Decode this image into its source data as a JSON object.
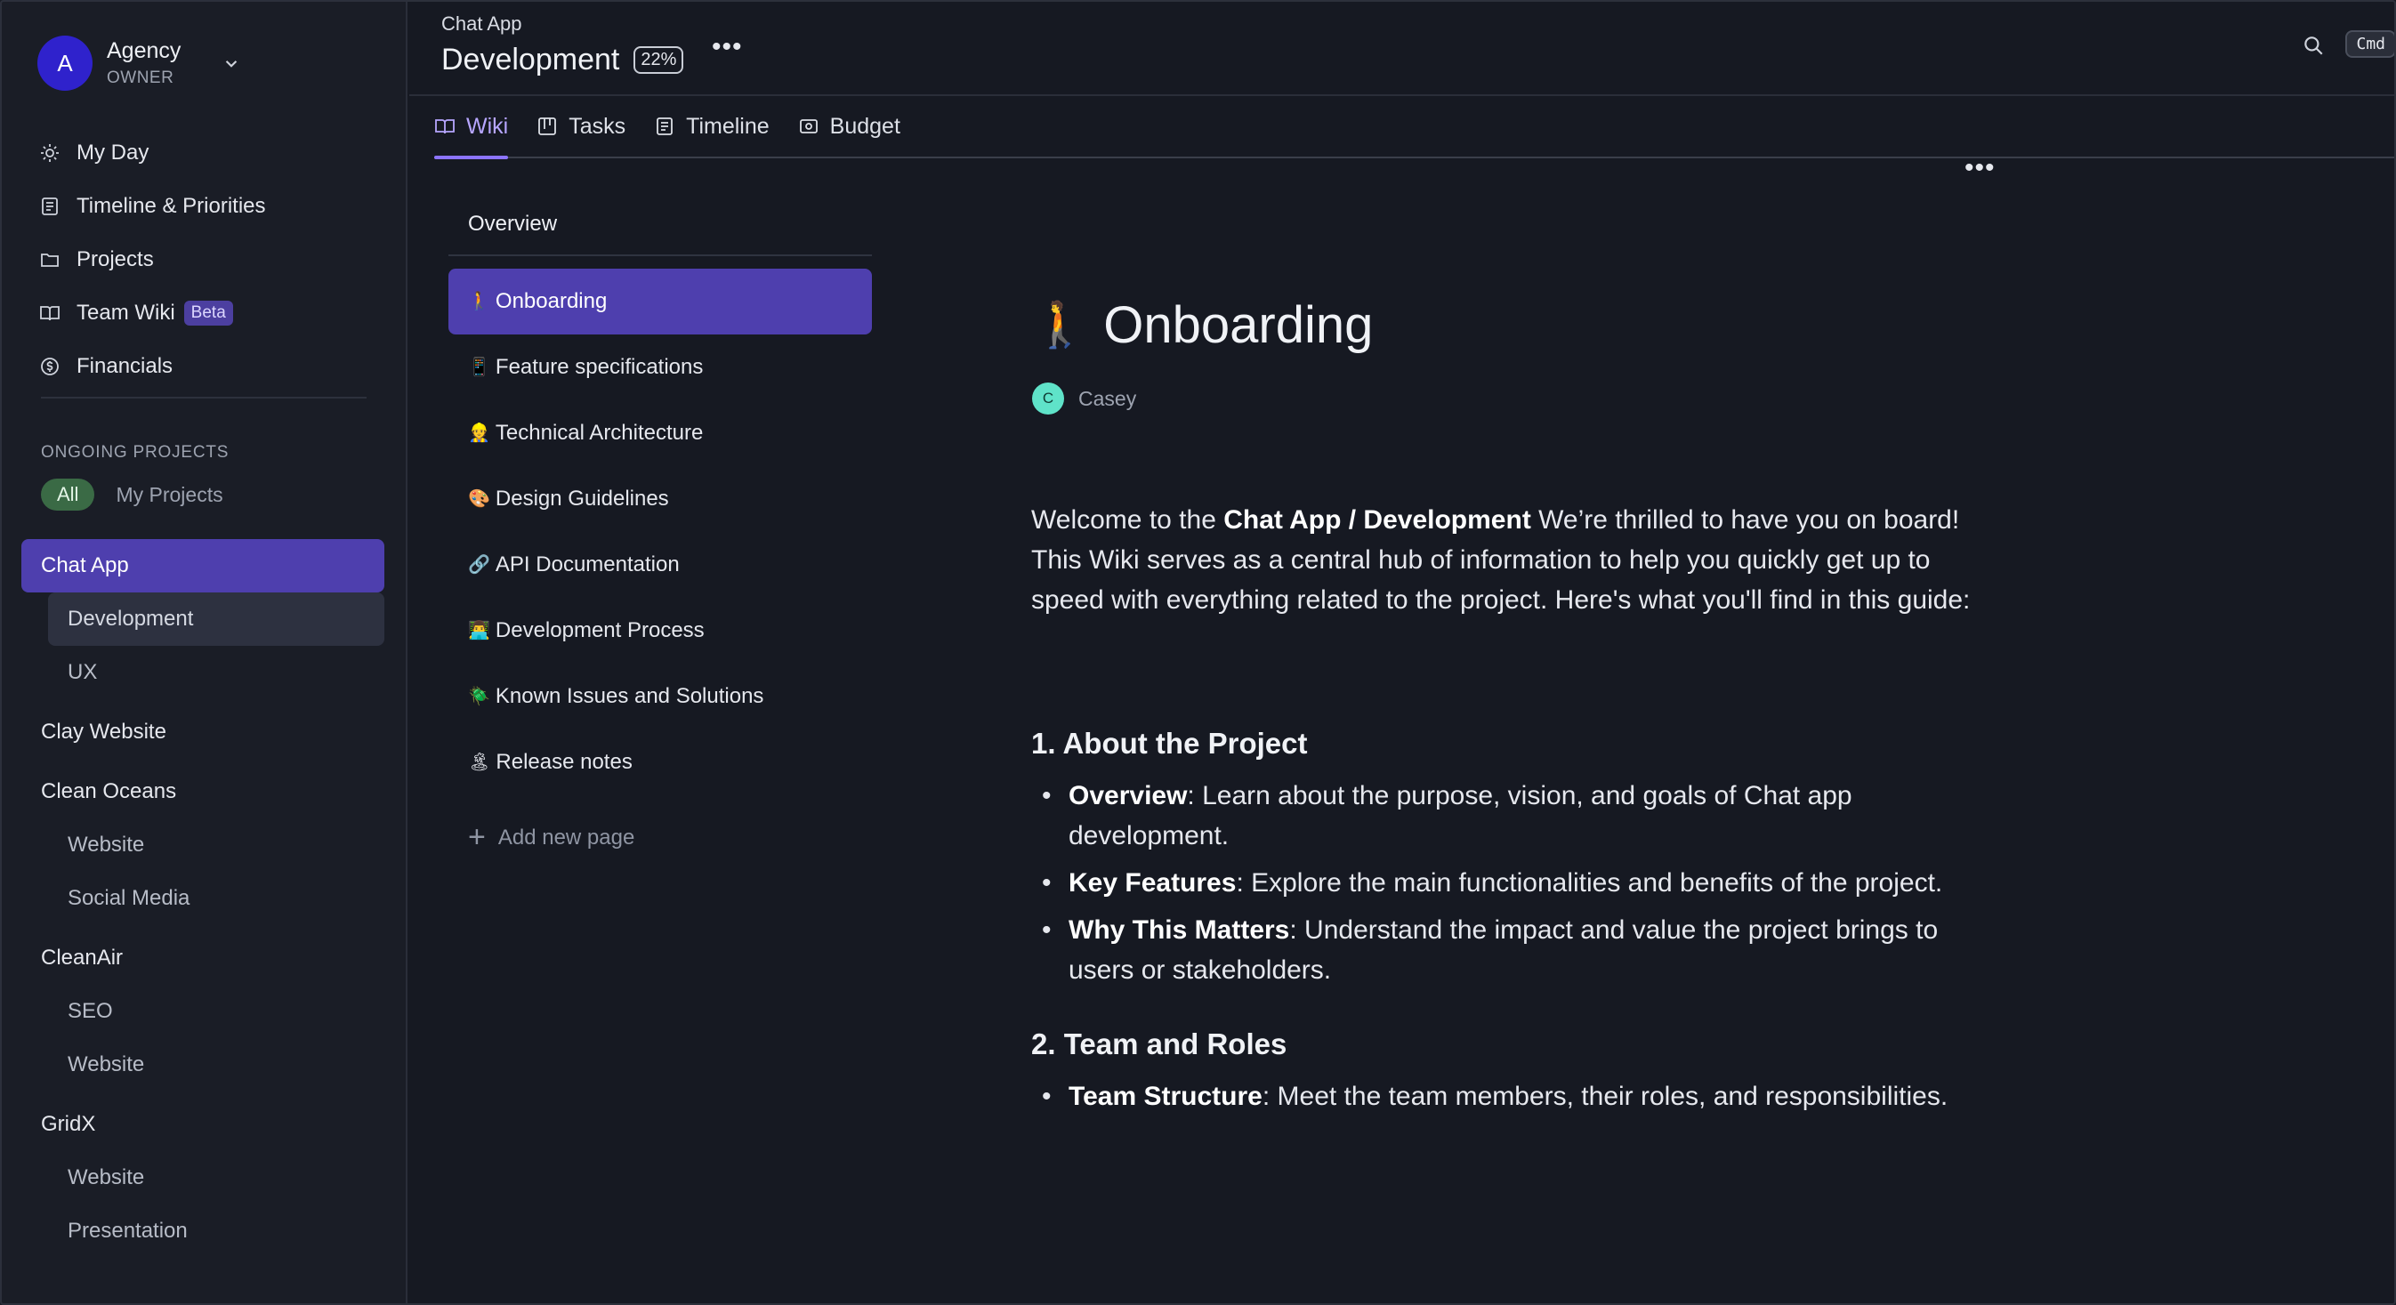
{
  "workspace": {
    "avatar_letter": "A",
    "name": "Agency",
    "role": "OWNER"
  },
  "nav": {
    "my_day": "My Day",
    "timeline": "Timeline & Priorities",
    "projects": "Projects",
    "team_wiki": "Team Wiki",
    "beta": "Beta",
    "financials": "Financials"
  },
  "ongoing": {
    "title": "ONGOING PROJECTS",
    "filter_all": "All",
    "filter_my": "My Projects"
  },
  "projects": {
    "chat_app": "Chat App",
    "chat_app_dev": "Development",
    "chat_app_ux": "UX",
    "clay": "Clay Website",
    "clean_oceans": "Clean Oceans",
    "clean_oceans_web": "Website",
    "clean_oceans_social": "Social Media",
    "cleanair": "CleanAir",
    "cleanair_seo": "SEO",
    "cleanair_web": "Website",
    "gridx": "GridX",
    "gridx_web": "Website",
    "gridx_pres": "Presentation"
  },
  "header": {
    "breadcrumb": "Chat App",
    "title": "Development",
    "progress": "22%",
    "cmd": "Cmd"
  },
  "tabs": {
    "wiki": "Wiki",
    "tasks": "Tasks",
    "timeline": "Timeline",
    "budget": "Budget"
  },
  "wiki": {
    "overview": "Overview",
    "pages": [
      {
        "emoji": "🚶",
        "label": "Onboarding"
      },
      {
        "emoji": "📱",
        "label": "Feature specifications"
      },
      {
        "emoji": "👷",
        "label": "Technical Architecture"
      },
      {
        "emoji": "🎨",
        "label": "Design Guidelines"
      },
      {
        "emoji": "🔗",
        "label": "API Documentation"
      },
      {
        "emoji": "👨‍💻",
        "label": "Development Process"
      },
      {
        "emoji": "🪲",
        "label": "Known Issues and Solutions"
      },
      {
        "emoji": "🏝",
        "label": "Release notes"
      }
    ],
    "add_page": "Add new page"
  },
  "doc": {
    "emoji": "🚶",
    "title": "Onboarding",
    "author_initial": "C",
    "author": "Casey",
    "intro_prefix": "Welcome to the ",
    "intro_bold": "Chat App / Development",
    "intro_rest": " We’re thrilled to have you on board! This Wiki serves as a central hub of information to help you quickly get up to speed with everything related to the project. Here's what you'll find in this guide:",
    "s1_title": "1. About the Project",
    "s1_items": [
      {
        "bold": "Overview",
        "text": ": Learn about the purpose, vision, and goals of Chat app development."
      },
      {
        "bold": "Key Features",
        "text": ": Explore the main functionalities and benefits of the project."
      },
      {
        "bold": "Why This Matters",
        "text": ": Understand the impact and value the project brings to users or stakeholders."
      }
    ],
    "s2_title": "2. Team and Roles",
    "s2_items": [
      {
        "bold": "Team Structure",
        "text": ": Meet the team members, their roles, and responsibilities."
      }
    ]
  }
}
